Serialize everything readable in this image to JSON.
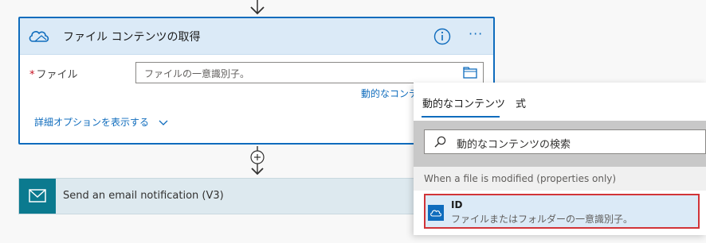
{
  "file_card": {
    "title": "ファイル コンテンツの取得",
    "more_label": "···",
    "field_required_mark": "*",
    "field_label": "ファイル",
    "field_placeholder": "ファイルの一意識別子。",
    "dynamic_link": "動的なコンテンツの追加",
    "advanced_options": "詳細オプションを表示する"
  },
  "email_card": {
    "title": "Send an email notification (V3)"
  },
  "dynamic_panel": {
    "tabs": [
      {
        "label": "動的なコンテンツ",
        "selected": true
      },
      {
        "label": "式",
        "selected": false
      }
    ],
    "search_placeholder": "動的なコンテンツの検索",
    "section_header": "When a file is modified (properties only)",
    "items": [
      {
        "name": "ID",
        "description": "ファイルまたはフォルダーの一意識別子。",
        "icon": "onedrive-cloud-icon"
      }
    ]
  },
  "colors": {
    "accent": "#0f6cbd",
    "card_header": "#dbeaf7",
    "email_icon_bg": "#0b7a8f",
    "highlight_border": "#d13438"
  }
}
